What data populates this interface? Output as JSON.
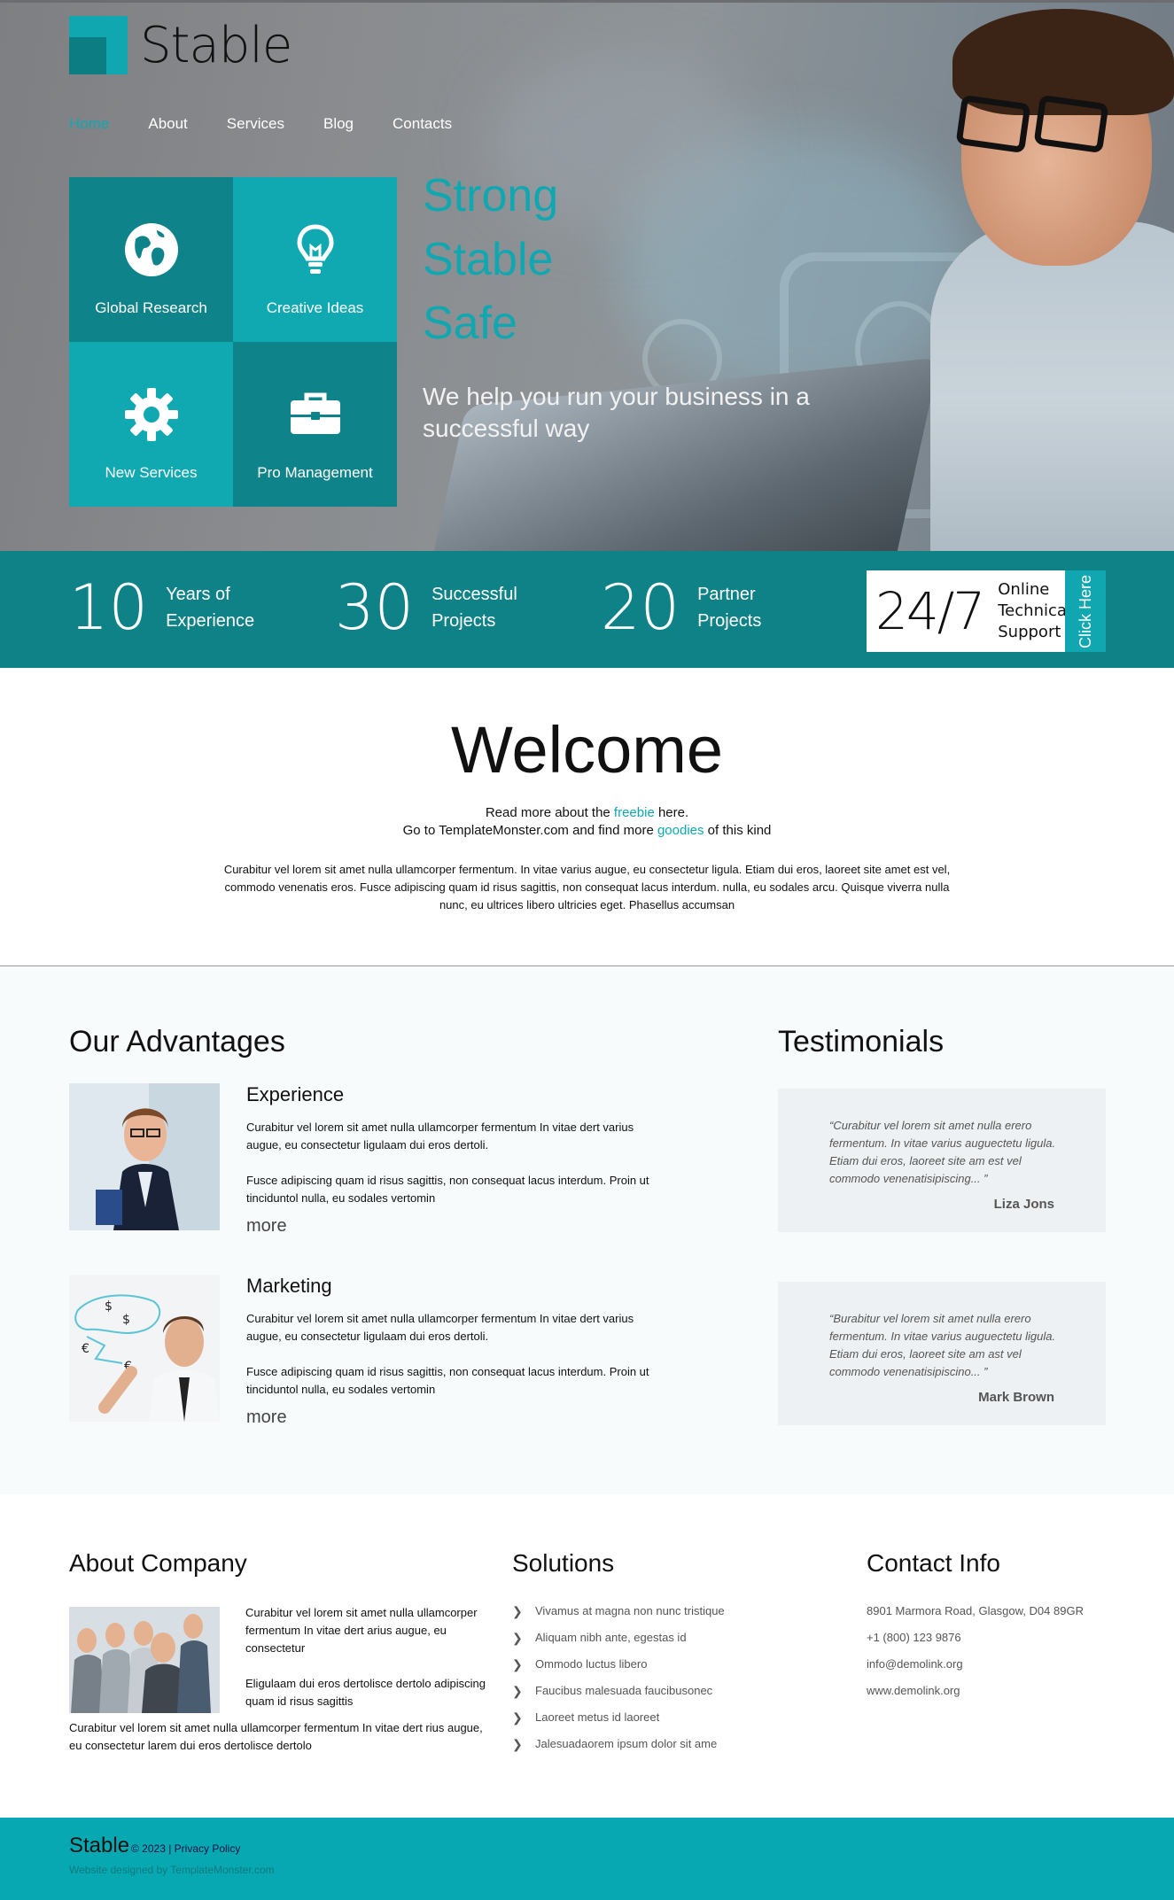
{
  "brand": {
    "name": "Stable",
    "accent": "#11a7b1",
    "dark_accent": "#0f8288"
  },
  "nav": {
    "items": [
      "Home",
      "About",
      "Services",
      "Blog",
      "Contacts"
    ],
    "active": "Home"
  },
  "tiles": [
    {
      "label": "Global Research",
      "icon": "globe-icon",
      "tone": "dark"
    },
    {
      "label": "Creative Ideas",
      "icon": "lightbulb-icon",
      "tone": "light"
    },
    {
      "label": "New Services",
      "icon": "gear-icon",
      "tone": "light"
    },
    {
      "label": "Pro Management",
      "icon": "briefcase-icon",
      "tone": "dark"
    }
  ],
  "hero": {
    "slogan": [
      "Strong",
      "Stable",
      "Safe"
    ],
    "subline": "We help you run your business in a successful way"
  },
  "stats": [
    {
      "number": "10",
      "label_line1": "Years of",
      "label_line2": "Experience"
    },
    {
      "number": "30",
      "label_line1": "Successful",
      "label_line2": "Projects"
    },
    {
      "number": "20",
      "label_line1": "Partner",
      "label_line2": "Projects"
    }
  ],
  "support": {
    "number": "24/7",
    "label_line1": "Online",
    "label_line2": "Technical",
    "label_line3": "Support",
    "button": "Click Here"
  },
  "welcome": {
    "title": "Welcome",
    "line1_pre": "Read more about the ",
    "line1_link": "freebie",
    "line1_post": " here.",
    "line2_pre": "Go to TemplateMonster.com and find more ",
    "line2_link": "goodies",
    "line2_post": " of this kind",
    "body": "Curabitur vel lorem sit amet nulla ullamcorper fermentum. In vitae varius augue, eu consectetur ligula. Etiam dui eros, laoreet site amet est vel, commodo venenatis eros. Fusce adipiscing quam id risus sagittis, non consequat lacus interdum. nulla, eu sodales arcu. Quisque viverra nulla nunc, eu ultrices libero ultricies eget. Phasellus accumsan"
  },
  "advantages": {
    "title": "Our Advantages",
    "items": [
      {
        "heading": "Experience",
        "p1": "Curabitur vel lorem sit amet nulla ullamcorper fermentum In vitae dert varius augue, eu consectetur ligulaam dui eros dertoli.",
        "p2": "Fusce adipiscing quam id risus sagittis, non consequat lacus interdum. Proin ut tinciduntol nulla, eu sodales vertomin",
        "more": "more"
      },
      {
        "heading": "Marketing",
        "p1": "Curabitur vel lorem sit amet nulla ullamcorper fermentum In vitae dert varius augue, eu consectetur ligulaam dui eros dertoli.",
        "p2": "Fusce adipiscing quam id risus sagittis, non consequat lacus interdum. Proin ut tinciduntol nulla, eu sodales vertomin",
        "more": "more"
      }
    ]
  },
  "testimonials": {
    "title": "Testimonials",
    "items": [
      {
        "quote": "“Curabitur vel lorem sit amet nulla erero fermentum. In vitae varius auguectetu ligula. Etiam dui eros, laoreet site am est vel commodo venenatisipiscing... ”",
        "author": "Liza Jons"
      },
      {
        "quote": "“Burabitur vel lorem sit amet nulla erero fermentum. In vitae varius auguectetu ligula. Etiam dui eros, laoreet site am ast vel commodo venenatisipiscino... ”",
        "author": "Mark Brown"
      }
    ]
  },
  "about": {
    "title": "About Company",
    "p1": "Curabitur vel lorem sit amet nulla ullamcorper fermentum In vitae dert arius augue, eu consectetur",
    "p2": "Eligulaam dui eros dertolisce dertolo adipiscing quam id risus sagittis",
    "p3": "Curabitur vel lorem sit amet nulla ullamcorper fermentum In vitae dert rius augue, eu consectetur larem dui eros dertolisce dertolo"
  },
  "solutions": {
    "title": "Solutions",
    "items": [
      "Vivamus at magna non nunc tristique",
      "Aliquam nibh ante, egestas id",
      "Ommodo luctus libero",
      "Faucibus malesuada faucibusonec",
      "Laoreet metus id laoreet",
      "Jalesuadaorem ipsum dolor sit ame"
    ]
  },
  "contact": {
    "title": "Contact Info",
    "address": "8901 Marmora Road, Glasgow, D04 89GR",
    "phone": "+1 (800) 123 9876",
    "email": "info@demolink.org",
    "website": "www.demolink.org"
  },
  "footer": {
    "brand": "Stable",
    "copyright": "© 2023 | Privacy Policy",
    "credit": "Website designed by TemplateMonster.com"
  }
}
